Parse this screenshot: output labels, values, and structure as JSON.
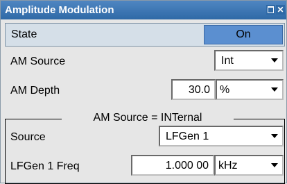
{
  "window": {
    "title": "Amplitude Modulation",
    "buttons": {
      "maximize": "maximize-icon",
      "close_glyph": "✕"
    }
  },
  "state": {
    "label": "State",
    "value": "On"
  },
  "am_source": {
    "label": "AM Source",
    "value": "Int"
  },
  "am_depth": {
    "label": "AM Depth",
    "value": "30.0",
    "unit": "%"
  },
  "group": {
    "title": "AM Source = INTernal",
    "source": {
      "label": "Source",
      "value": "LFGen 1"
    },
    "freq": {
      "label": "LFGen 1 Freq",
      "value": "1.000 00",
      "unit": "kHz"
    }
  },
  "colors": {
    "title_bar": "#2f69a6",
    "on_button": "#5b8fd0",
    "state_row": "#d5dfe8",
    "background": "#e6e6e6"
  }
}
